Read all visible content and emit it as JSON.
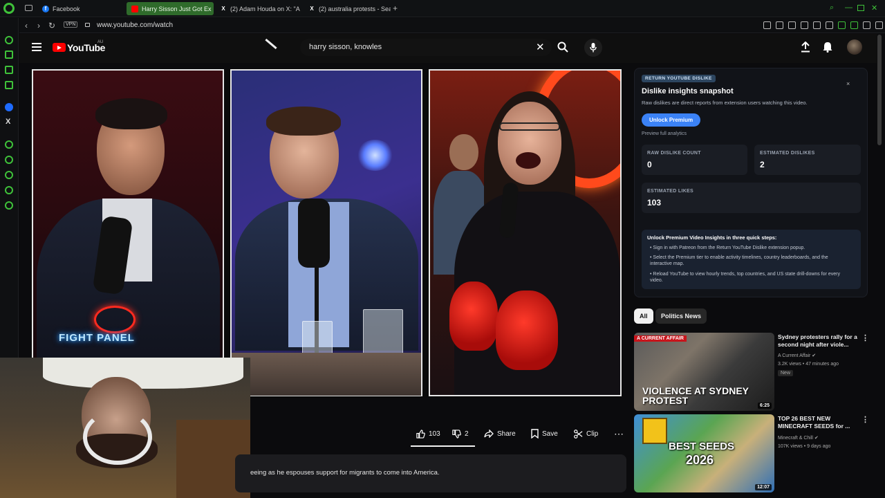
{
  "browser": {
    "tabs": [
      {
        "label": "Facebook",
        "favicon": "facebook-icon",
        "color": "#1877f2"
      },
      {
        "label": "Harry Sisson Just Got Ex",
        "favicon": "youtube-icon",
        "color": "#ff0000",
        "active": true
      },
      {
        "label": "(2) Adam Houda on X: \"A",
        "favicon": "x-icon",
        "color": "#ffffff"
      },
      {
        "label": "(2) australia protests - Sea",
        "favicon": "x-icon",
        "color": "#ffffff"
      }
    ],
    "new_tab": "+",
    "url": "www.youtube.com/watch",
    "vpn_label": "VPN",
    "accent": "#3fc23a"
  },
  "youtube": {
    "logo_text": "YouTube",
    "region": "AU",
    "search_value": "harry sisson, knowles",
    "search_clear": "✕"
  },
  "video": {
    "overlay_text": "FIGHT PANEL"
  },
  "actions": {
    "likes": "103",
    "dislikes": "2",
    "share": "Share",
    "save": "Save",
    "clip": "Clip",
    "more": "⋯"
  },
  "description": {
    "text": "eeing as he espouses support for migrants to come into America."
  },
  "dislike_panel": {
    "badge": "RETURN YOUTUBE DISLIKE",
    "title": "Dislike insights snapshot",
    "subtitle": "Raw dislikes are direct reports from extension users watching this video.",
    "close": "×",
    "unlock_button": "Unlock Premium",
    "preview": "Preview full analytics",
    "raw_dislike_label": "RAW DISLIKE COUNT",
    "raw_dislike_value": "0",
    "est_dislike_label": "ESTIMATED DISLIKES",
    "est_dislike_value": "2",
    "est_likes_label": "ESTIMATED LIKES",
    "est_likes_value": "103",
    "steps_title": "Unlock Premium Video Insights in three quick steps:",
    "steps": [
      "Sign in with Patreon from the Return YouTube Dislike extension popup.",
      "Select the Premium tier to enable activity timelines, country leaderboards, and the interactive map.",
      "Reload YouTube to view hourly trends, top countries, and US state drill-downs for every video."
    ],
    "accent": "#3b82f6"
  },
  "chips": [
    "All",
    "Politics News"
  ],
  "recommendations": [
    {
      "title": "Sydney protesters rally for a second night after viole...",
      "channel": "A Current Affair",
      "meta": "3.2K views • 47 minutes ago",
      "badge": "New",
      "thumb_brand": "A CURRENT AFFAIR",
      "thumb_text": "VIOLENCE AT SYDNEY PROTEST",
      "duration": "6:25"
    },
    {
      "title": "TOP 26 BEST NEW MINECRAFT SEEDS for ...",
      "channel": "Minecraft & Chill",
      "meta": "107K views • 9 days ago",
      "thumb_text_1": "BEST SEEDS",
      "thumb_text_2": "2026",
      "duration": "12:07"
    }
  ]
}
